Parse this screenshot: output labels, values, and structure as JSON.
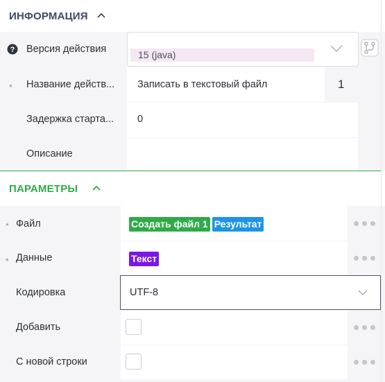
{
  "info_section": {
    "title": "ИНФОРМАЦИЯ",
    "rows": [
      {
        "label": "Версия действия",
        "value": "15 (java)"
      },
      {
        "label": "Название действ...",
        "value": "Записать в текстовый файл",
        "extra": "1"
      },
      {
        "label": "Задержка старта...",
        "value": "0"
      },
      {
        "label": "Описание",
        "value": ""
      }
    ]
  },
  "params_section": {
    "title": "ПАРАМЕТРЫ",
    "rows": [
      {
        "label": "Файл",
        "tags": [
          "Создать файл 1",
          "Результат"
        ]
      },
      {
        "label": "Данные",
        "tags": [
          "Текст"
        ]
      },
      {
        "label": "Кодировка",
        "value": "UTF-8"
      },
      {
        "label": "Добавить"
      },
      {
        "label": "С новой строки"
      }
    ]
  },
  "required_mark": "*",
  "help_icon_glyph": "?",
  "colors": {
    "info_title": "#3d4a63",
    "params_accent": "#2eab48",
    "tag_green": "#2eab48",
    "tag_blue": "#1e94e8",
    "tag_purple": "#7b16e8",
    "row_bg": "#f5f5f7",
    "version_bg": "#f4e8f4"
  }
}
